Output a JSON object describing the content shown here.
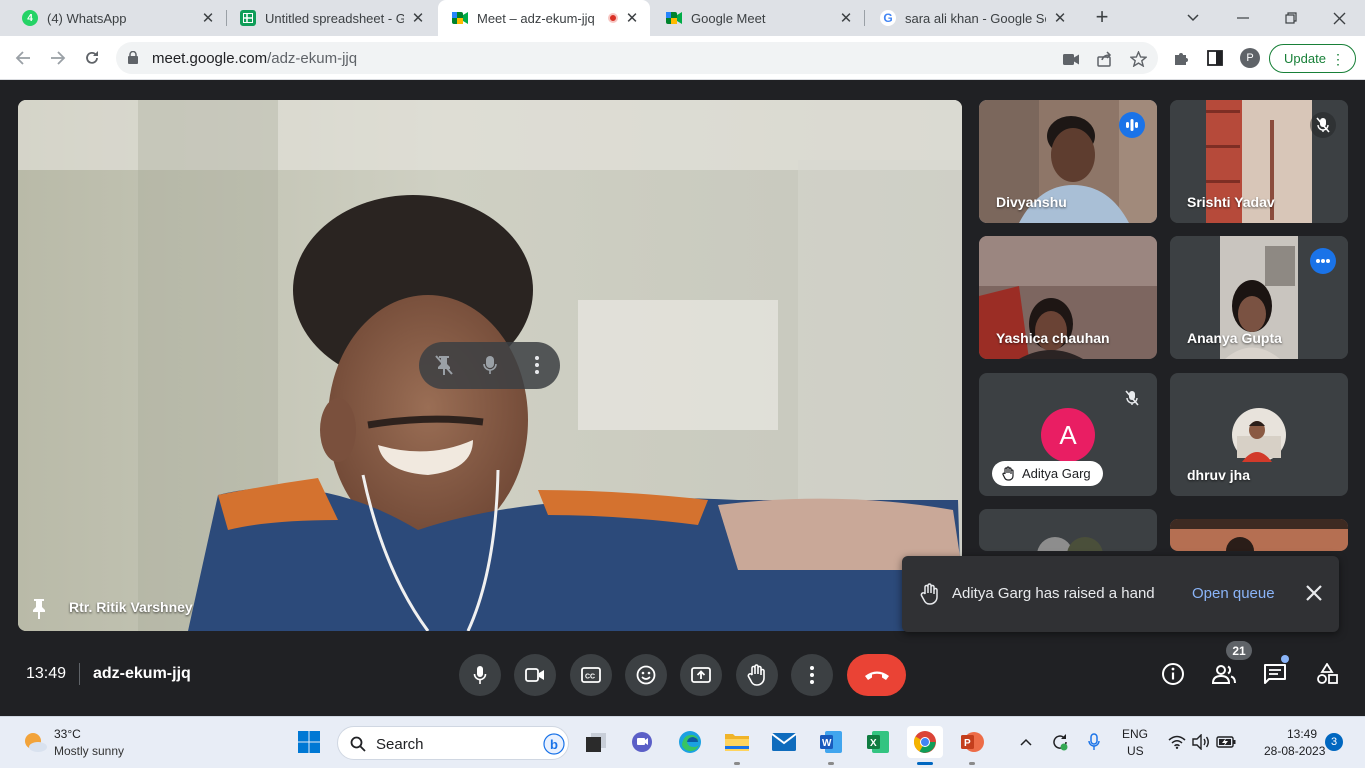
{
  "browser": {
    "tabs": [
      {
        "label": "(4) WhatsApp",
        "favicon": "whatsapp-icon"
      },
      {
        "label": "Untitled spreadsheet - Go",
        "favicon": "sheets-icon"
      },
      {
        "label": "Meet – adz-ekum-jjq",
        "favicon": "meet-icon",
        "active": true,
        "recording": true
      },
      {
        "label": "Google Meet",
        "favicon": "meet-icon"
      },
      {
        "label": "sara ali khan - Google Sea",
        "favicon": "google-icon"
      }
    ],
    "whatsapp_badge": "4",
    "url_host": "meet.google.com",
    "url_path": "/adz-ekum-jjq",
    "profile_initial": "P",
    "update_label": "Update",
    "accent": "#188038"
  },
  "meet": {
    "main_speaker": "Rtr. Ritik Varshney",
    "participants": [
      {
        "name": "Divyanshu",
        "status": "speaking"
      },
      {
        "name": "Srishti Yadav",
        "status": "muted"
      },
      {
        "name": "Yashica chauhan",
        "status": ""
      },
      {
        "name": "Ananya Gupta",
        "status": "speaking"
      },
      {
        "name": "Aditya Garg",
        "status": "muted",
        "avatar_letter": "A",
        "avatar_color": "#e91e63",
        "hand_raised": true
      },
      {
        "name": "dhruv jha",
        "status": ""
      }
    ],
    "toast": {
      "message": "Aditya Garg has raised a hand",
      "action": "Open queue"
    },
    "time": "13:49",
    "meeting_code": "adz-ekum-jjq",
    "people_count": "21",
    "end_call_color": "#ea4335"
  },
  "taskbar": {
    "weather_temp": "33°C",
    "weather_desc": "Mostly sunny",
    "search_label": "Search",
    "lang_line1": "ENG",
    "lang_line2": "US",
    "clock_time": "13:49",
    "clock_date": "28-08-2023",
    "notification_count": "3"
  }
}
